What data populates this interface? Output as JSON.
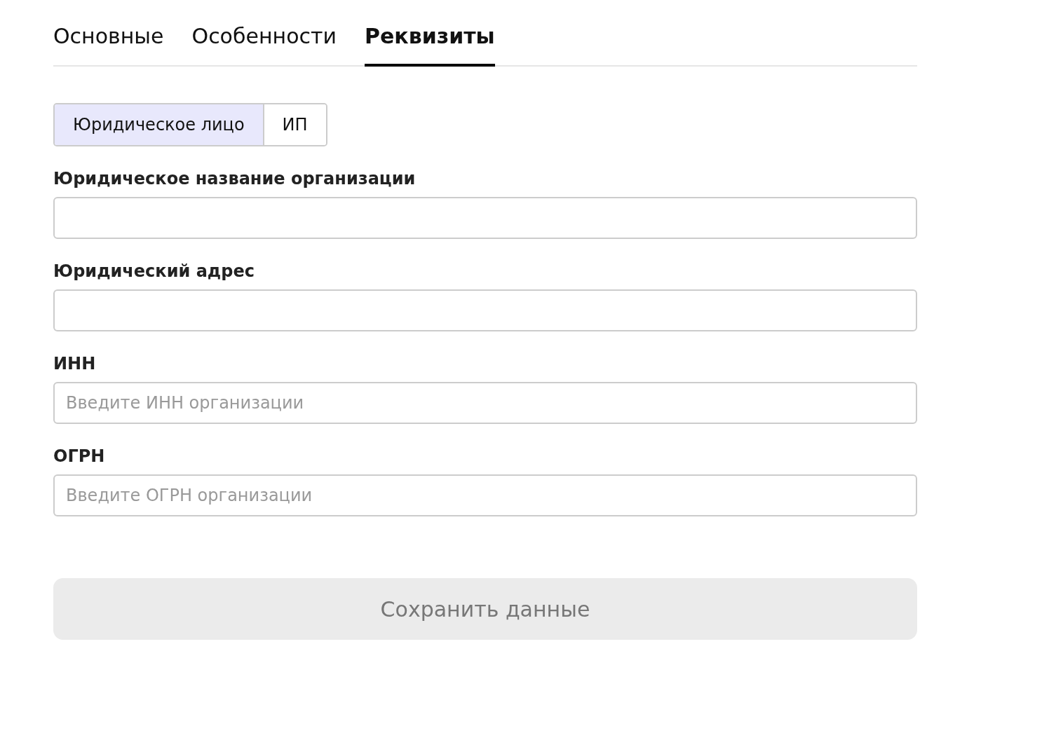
{
  "tabs": [
    {
      "label": "Основные",
      "selected": false
    },
    {
      "label": "Особенности",
      "selected": false
    },
    {
      "label": "Реквизиты",
      "selected": true
    }
  ],
  "entity_type": [
    {
      "label": "Юридическое лицо",
      "selected": true
    },
    {
      "label": "ИП",
      "selected": false
    }
  ],
  "fields": [
    {
      "label": "Юридическое название организации"
    },
    {
      "label": "Юридический адрес"
    },
    {
      "label": "ИНН",
      "placeholder": "Введите ИНН организации"
    },
    {
      "label": "ОГРН",
      "placeholder": "Введите ОГРН организации"
    }
  ],
  "save_button": {
    "label": "Сохранить данные",
    "disabled": true
  }
}
